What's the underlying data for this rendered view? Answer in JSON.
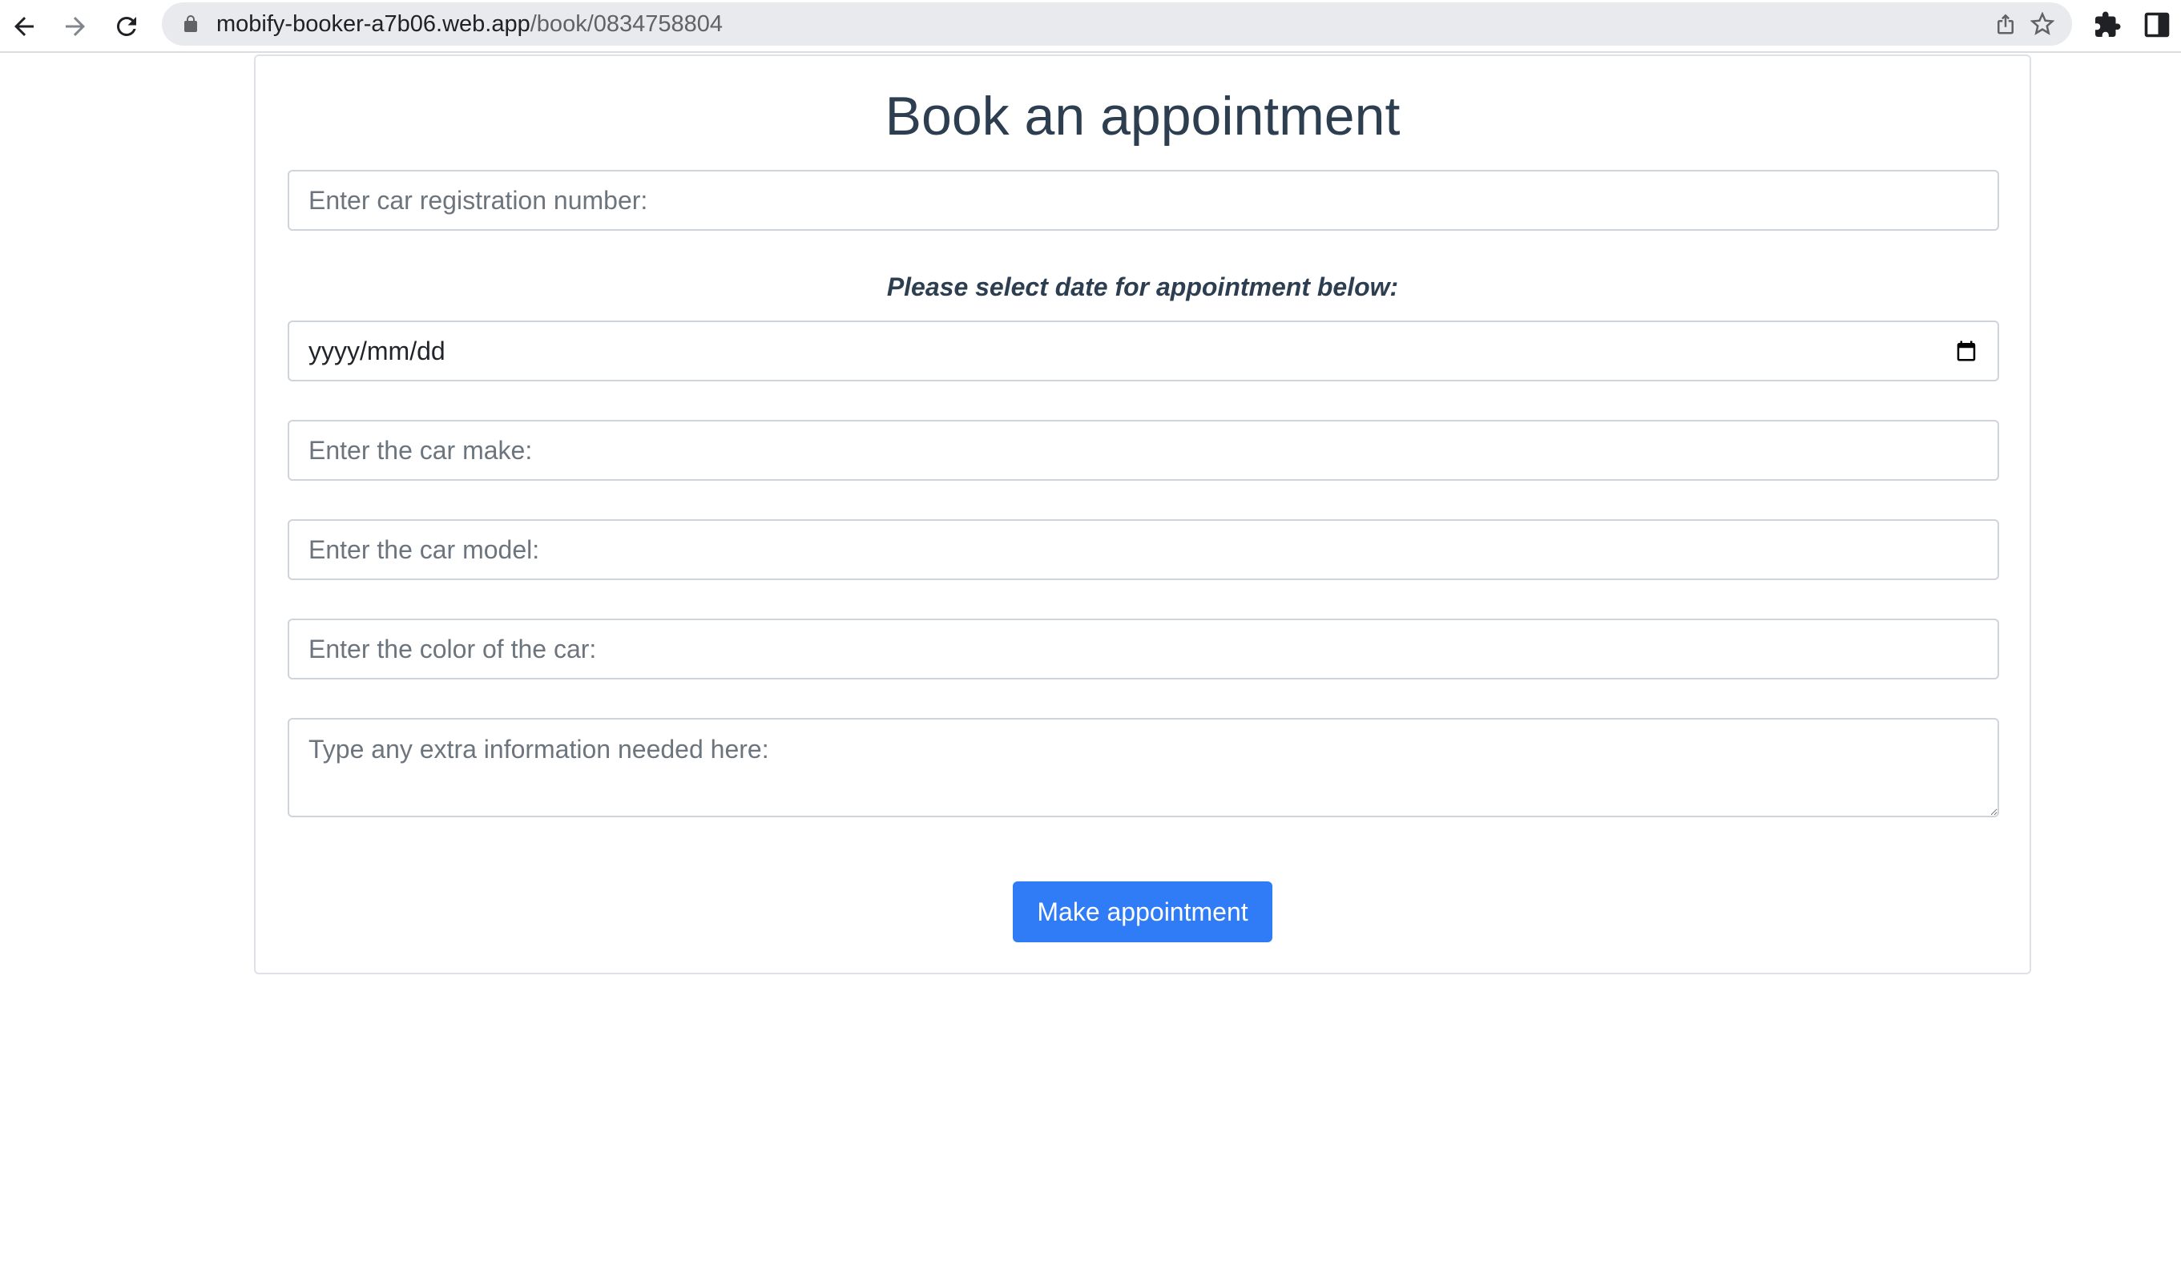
{
  "browser": {
    "url_host": "mobify-booker-a7b06.web.app",
    "url_path": "/book/0834758804",
    "icons": [
      "back-arrow-icon",
      "forward-arrow-icon",
      "reload-icon",
      "lock-icon",
      "share-icon",
      "star-icon",
      "extensions-puzzle-icon",
      "side-panel-icon"
    ]
  },
  "form": {
    "title": "Book an appointment",
    "registration_placeholder": "Enter car registration number:",
    "date_label": "Please select date for appointment below:",
    "date_value": "yyyy/mm/dd",
    "make_placeholder": "Enter the car make:",
    "model_placeholder": "Enter the car model:",
    "color_placeholder": "Enter the color of the car:",
    "extra_placeholder": "Type any extra information needed here:",
    "submit_label": "Make appointment"
  },
  "colors": {
    "accent": "#2f7cf6",
    "heading": "#2c3e50",
    "border": "#ced4da"
  }
}
